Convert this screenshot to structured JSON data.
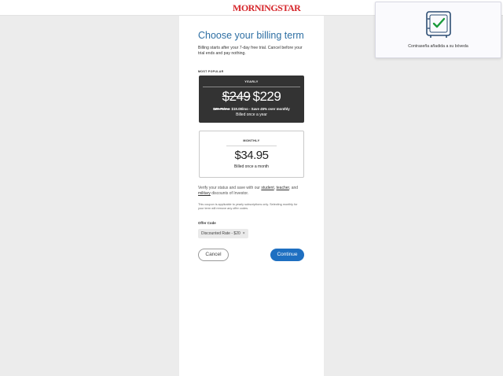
{
  "header": {
    "logo_text": "MORNINGSTAR"
  },
  "billing": {
    "title": "Choose your billing term",
    "subtitle": "Billing starts after your 7-day free trial. Cancel before your trial ends and pay nothing.",
    "badge": "MOST POPULAR",
    "yearly": {
      "name": "YEARLY",
      "old_price": "$249",
      "price": "$229",
      "old_monthly": "$20.75/mo",
      "detail": "$19.08/mo - Save 45% over monthly",
      "billed": "Billed once a year"
    },
    "monthly": {
      "name": "MONTHLY",
      "price": "$34.95",
      "billed": "Billed once a month"
    },
    "verify_prefix": "Verify your status and save with our ",
    "verify_student": "student",
    "verify_sep": ", ",
    "verify_teacher": "teacher",
    "verify_and": ", and ",
    "verify_military": "military",
    "verify_suffix": " discounts of Investor.",
    "coupon_note": "This coupon is applicable to yearly subscriptions only. Selecting monthly for your term will remove any offer codes.",
    "offer_label": "Offer Code",
    "offer_chip": "Discounted Rate - $20",
    "offer_chip_close": "×",
    "cancel_label": "Cancel",
    "continue_label": "Continue"
  },
  "toast": {
    "message": "Contraseña añadida a su bóveda",
    "icon": "vault-check-icon"
  },
  "colors": {
    "accent": "#1e6fc1",
    "title": "#2e6fa3",
    "logo": "#d6262b",
    "check": "#1a9b3a",
    "yearly_bg": "#333333"
  }
}
